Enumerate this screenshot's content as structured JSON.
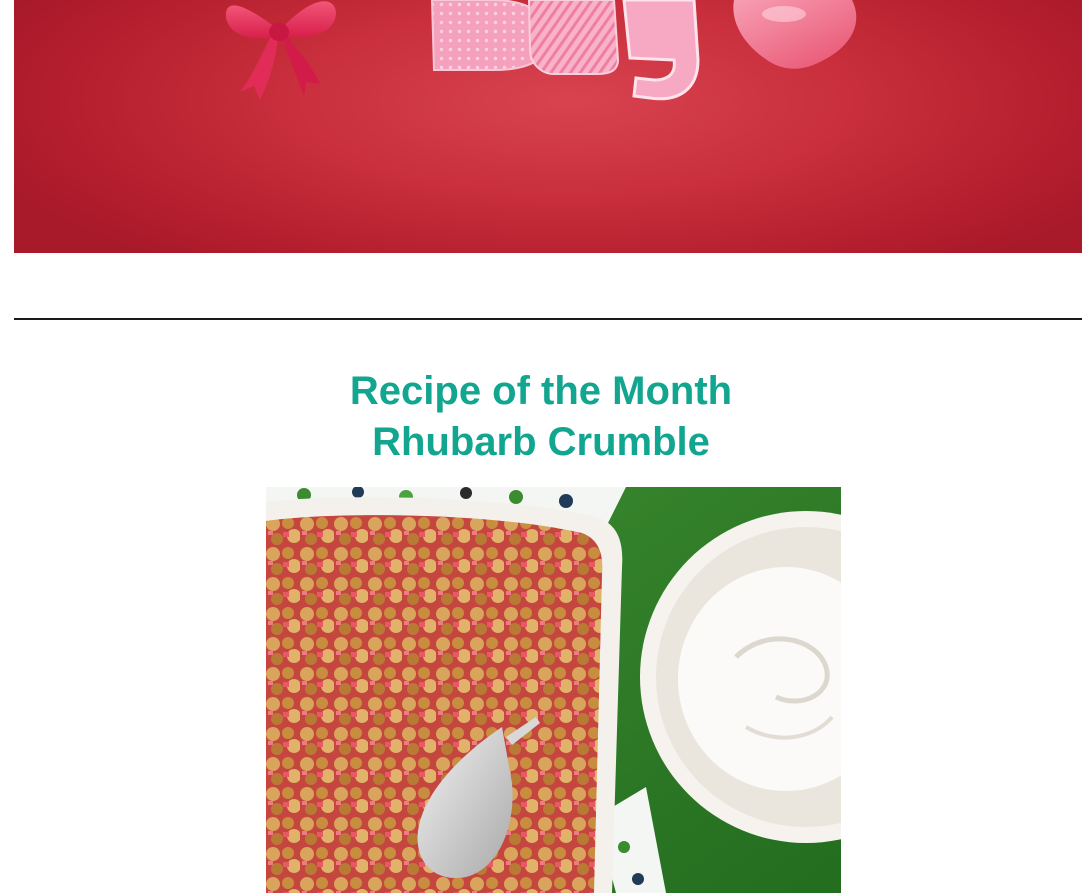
{
  "banner": {
    "graphic": "valentines-day-banner-with-ribbon-bow-and-heart",
    "colors": {
      "background": "#c92f3c",
      "ribbon": "#e8395e",
      "letters": "#f7a9c4",
      "heart": "#f2607f"
    }
  },
  "recipe": {
    "heading_line1": "Recipe of the Month",
    "heading_line2": "Rhubarb Crumble",
    "heading_color": "#12a58f",
    "photo": "rhubarb-crumble-dish-with-whipped-cream"
  }
}
